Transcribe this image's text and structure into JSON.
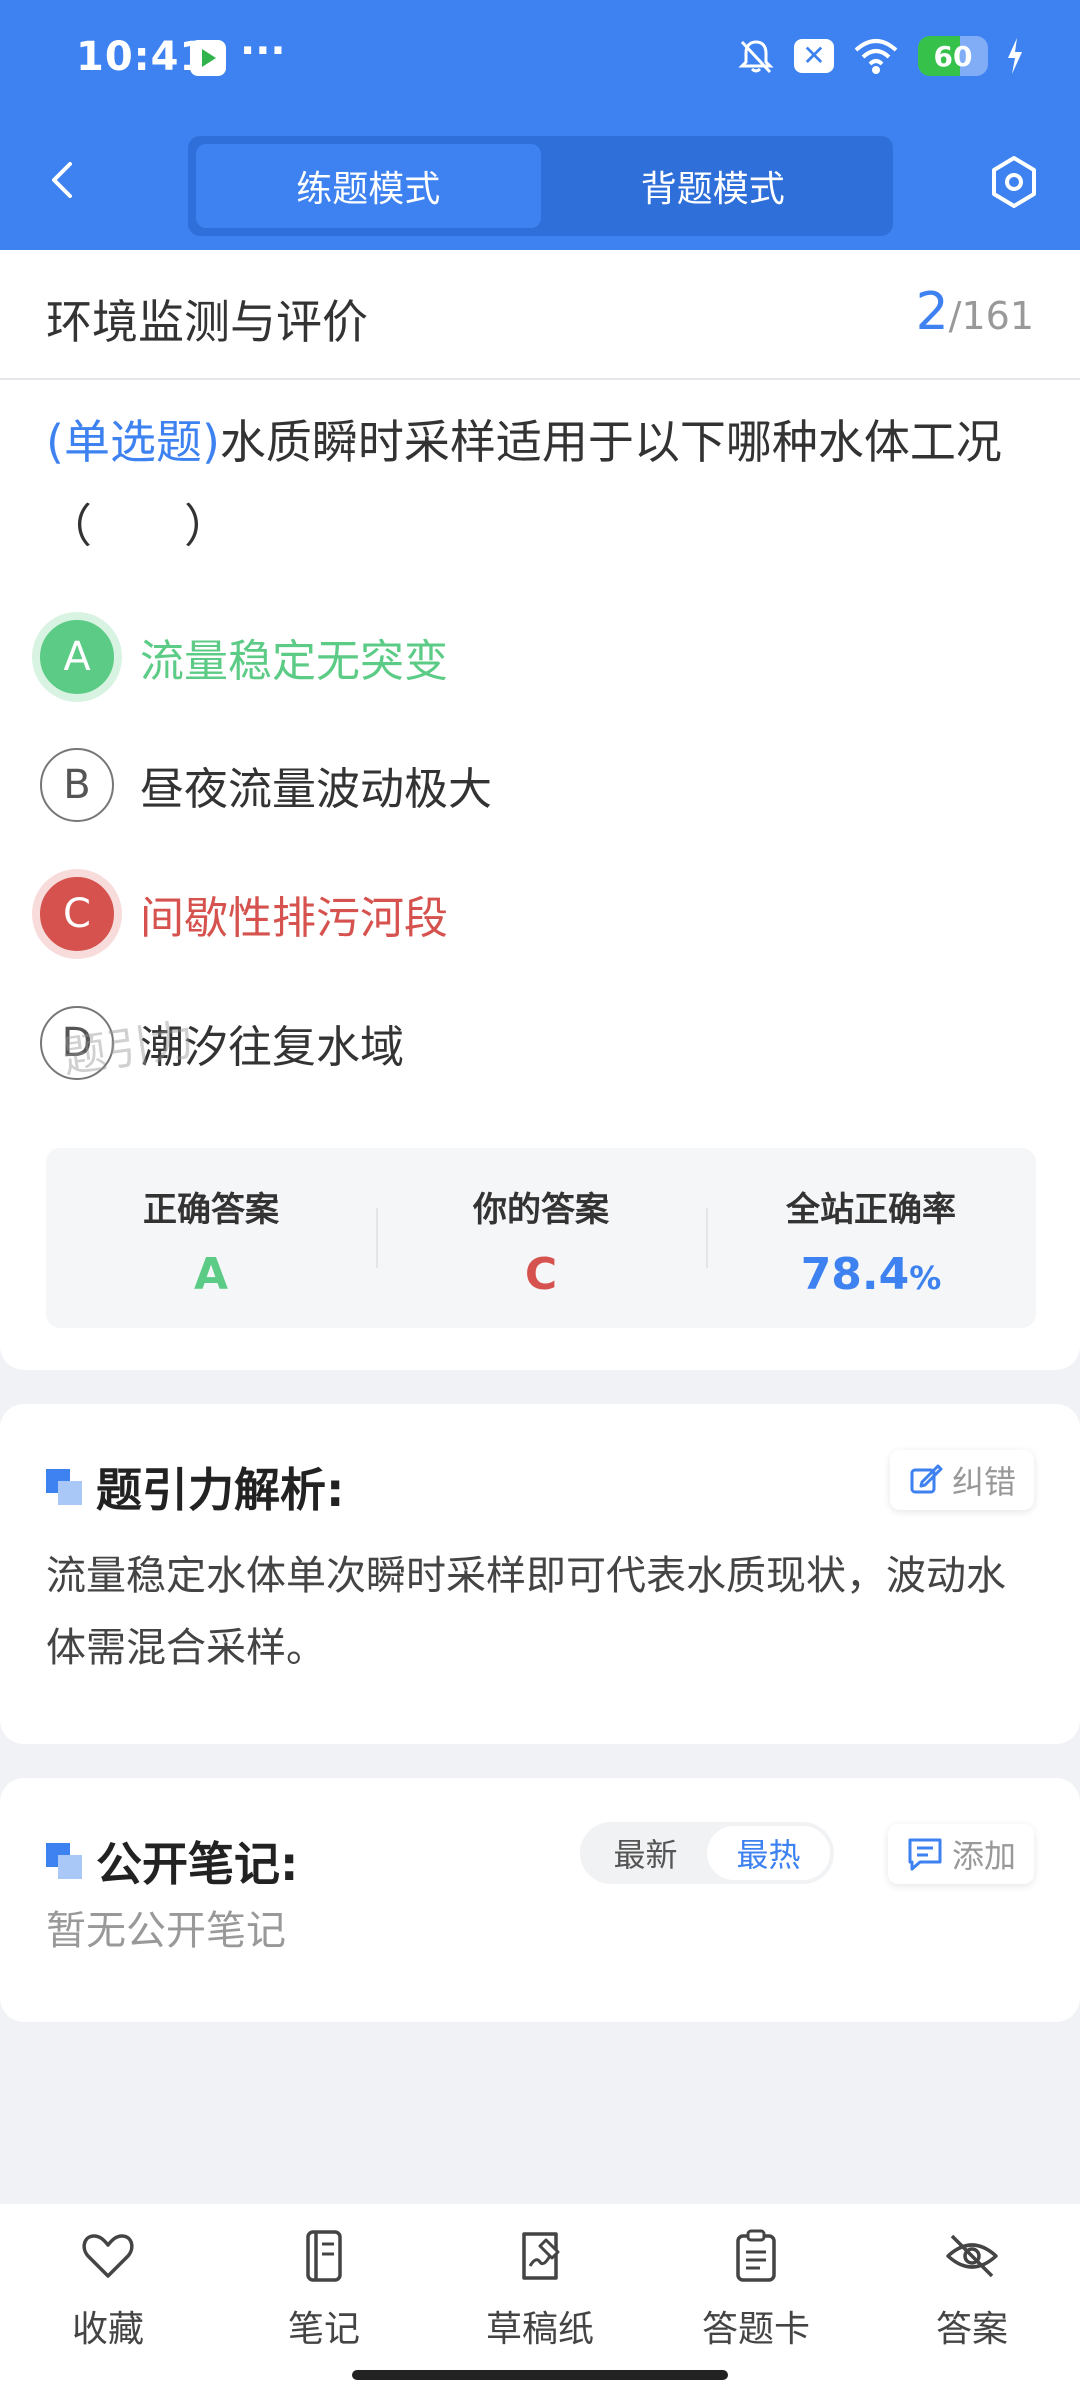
{
  "status_bar": {
    "time": "10:41",
    "dots": "···",
    "battery_level": "60"
  },
  "nav": {
    "modes": [
      "练题模式",
      "背题模式"
    ],
    "active_mode": "练题模式"
  },
  "question": {
    "subject": "环境监测与评价",
    "current": "2",
    "total": "/161",
    "type_label": "(单选题)",
    "text": "水质瞬时采样适用于以下哪种水体工况（　　）",
    "options": [
      {
        "letter": "A",
        "text": "流量稳定无突变",
        "state": "correct"
      },
      {
        "letter": "B",
        "text": "昼夜流量波动极大",
        "state": "normal"
      },
      {
        "letter": "C",
        "text": "间歇性排污河段",
        "state": "wrong"
      },
      {
        "letter": "D",
        "text": "潮汐往复水域",
        "state": "normal"
      }
    ]
  },
  "stats": {
    "correct_label": "正确答案",
    "correct_value": "A",
    "yours_label": "你的答案",
    "yours_value": "C",
    "rate_label": "全站正确率",
    "rate_value": "78.4",
    "rate_unit": "%",
    "watermark": "题引力"
  },
  "analysis": {
    "title": "题引力解析:",
    "report_label": "纠错",
    "text": "流量稳定水体单次瞬时采样即可代表水质现状，波动水体需混合采样。"
  },
  "notes": {
    "title": "公开笔记:",
    "sort_options": [
      "最新",
      "最热"
    ],
    "active_sort": "最热",
    "add_label": "添加",
    "empty_text": "暂无公开笔记"
  },
  "bottom_bar": {
    "items": [
      {
        "label": "收藏",
        "icon": "heart-icon"
      },
      {
        "label": "笔记",
        "icon": "notebook-icon"
      },
      {
        "label": "草稿纸",
        "icon": "draft-paper-icon"
      },
      {
        "label": "答题卡",
        "icon": "answer-sheet-icon"
      },
      {
        "label": "答案",
        "icon": "eye-off-icon"
      }
    ]
  },
  "colors": {
    "brand_blue": "#3d82f0",
    "correct_green": "#5ccb85",
    "wrong_red": "#d5524e"
  }
}
